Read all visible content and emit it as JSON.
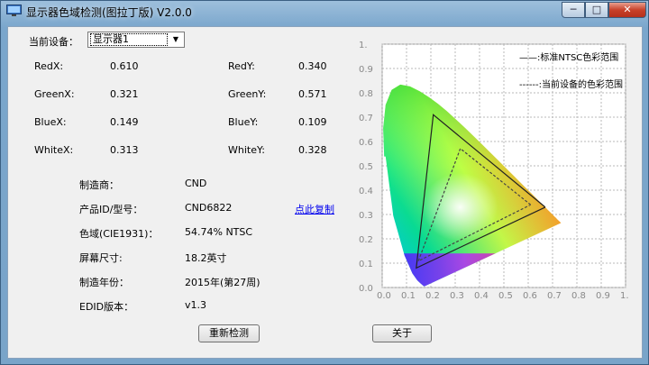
{
  "window": {
    "title": "显示器色域检测(图拉丁版) V2.0.0",
    "min_glyph": "─",
    "max_glyph": "□",
    "close_glyph": "✕"
  },
  "device": {
    "label": "当前设备：",
    "selected": "显示器1",
    "arrow": "▼"
  },
  "coords": [
    {
      "xlabel": "RedX:",
      "xvalue": "0.610",
      "ylabel": "RedY:",
      "yvalue": "0.340"
    },
    {
      "xlabel": "GreenX:",
      "xvalue": "0.321",
      "ylabel": "GreenY:",
      "yvalue": "0.571"
    },
    {
      "xlabel": "BlueX:",
      "xvalue": "0.149",
      "ylabel": "BlueY:",
      "yvalue": "0.109"
    },
    {
      "xlabel": "WhiteX:",
      "xvalue": "0.313",
      "ylabel": "WhiteY:",
      "yvalue": "0.328"
    }
  ],
  "info": [
    {
      "label": "制造商：",
      "value": "CND"
    },
    {
      "label": "产品ID/型号：",
      "value": "CND6822"
    },
    {
      "label": "色域(CIE1931)：",
      "value": "54.74% NTSC"
    },
    {
      "label": "屏幕尺寸:",
      "value": "18.2英寸"
    },
    {
      "label": "制造年份：",
      "value": "2015年(第27周)"
    },
    {
      "label": "EDID版本：",
      "value": "v1.3"
    }
  ],
  "copy_link": "点此复制",
  "buttons": {
    "redetect": "重新检测",
    "about": "关于"
  },
  "chart_data": {
    "type": "scatter",
    "title": "",
    "xlabel": "",
    "ylabel": "",
    "xlim": [
      0,
      1
    ],
    "ylim": [
      0,
      1
    ],
    "x_ticks": [
      "0.0",
      "0.1",
      "0.2",
      "0.3",
      "0.4",
      "0.5",
      "0.6",
      "0.7",
      "0.8",
      "0.9",
      "1."
    ],
    "y_ticks": [
      "0.0",
      "0.1",
      "0.2",
      "0.3",
      "0.4",
      "0.5",
      "0.6",
      "0.7",
      "0.8",
      "0.9",
      "1."
    ],
    "grid": true,
    "legend_position": "top-right",
    "series": [
      {
        "name": "——:标准NTSC色彩范围",
        "style": "solid",
        "points": [
          [
            0.67,
            0.33
          ],
          [
            0.21,
            0.71
          ],
          [
            0.14,
            0.08
          ],
          [
            0.67,
            0.33
          ]
        ]
      },
      {
        "name": "------:当前设备的色彩范围",
        "style": "dashed",
        "points": [
          [
            0.61,
            0.34
          ],
          [
            0.321,
            0.571
          ],
          [
            0.149,
            0.109
          ],
          [
            0.61,
            0.34
          ]
        ]
      }
    ]
  }
}
